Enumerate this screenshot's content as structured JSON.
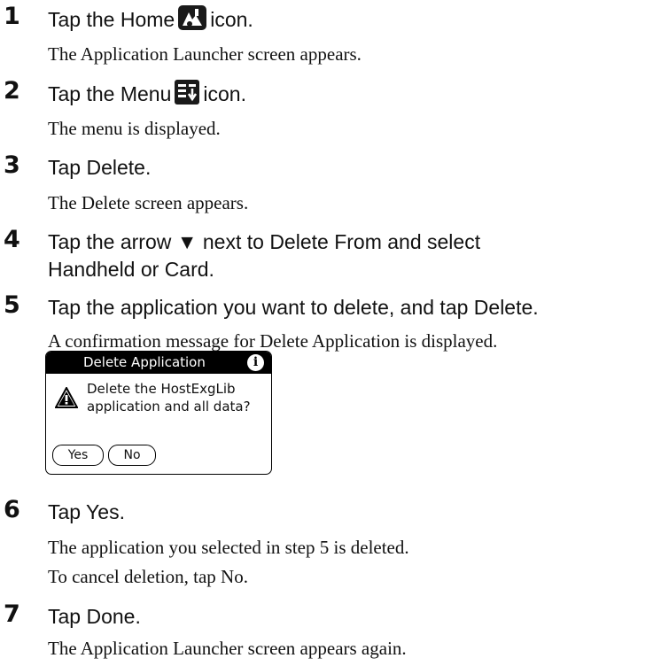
{
  "steps": [
    {
      "number": "1",
      "instruction_before": "Tap the Home",
      "icon": "home-icon",
      "instruction_after": "icon.",
      "description": "The Application Launcher screen appears."
    },
    {
      "number": "2",
      "instruction_before": "Tap the Menu",
      "icon": "menu-icon",
      "instruction_after": "icon.",
      "description": "The menu is displayed."
    },
    {
      "number": "3",
      "instruction": "Tap Delete.",
      "description": "The Delete screen appears."
    },
    {
      "number": "4",
      "instruction_line1": "Tap the arrow ▼ next to Delete From and select",
      "instruction_line2": "Handheld or Card."
    },
    {
      "number": "5",
      "instruction": "Tap the application you want to delete, and tap Delete.",
      "description": "A confirmation message for Delete Application is displayed."
    },
    {
      "number": "6",
      "instruction": "Tap Yes.",
      "description": "The application you selected in step 5 is deleted.",
      "description2": "To cancel deletion, tap No."
    },
    {
      "number": "7",
      "instruction": "Tap Done.",
      "description": "The Application Launcher screen appears again."
    }
  ],
  "dialog": {
    "title": "Delete Application",
    "info_icon": "i",
    "warning_icon": "warning-icon",
    "message_line1": "Delete the HostExgLib",
    "message_line2": "application and all data?",
    "yes_label": "Yes",
    "no_label": "No"
  }
}
